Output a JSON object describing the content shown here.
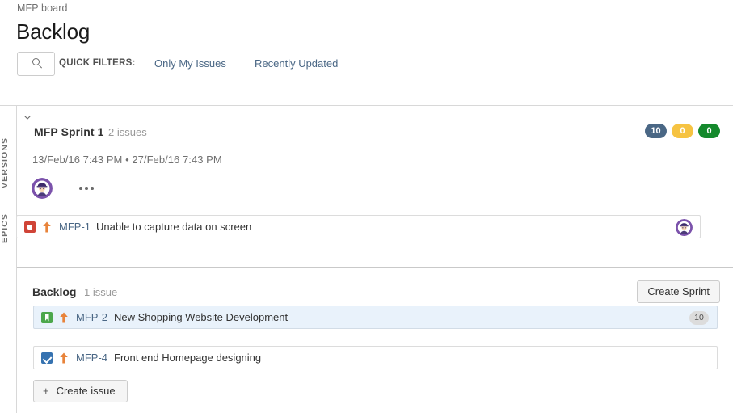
{
  "header": {
    "breadcrumb": "MFP board",
    "title": "Backlog",
    "quick_filters_label": "QUICK FILTERS:",
    "quick_filters": [
      {
        "label": "Only My Issues"
      },
      {
        "label": "Recently Updated"
      }
    ],
    "search_placeholder": "",
    "search_value": "",
    "search_icon": "search-icon"
  },
  "rail": {
    "versions_label": "VERSIONS",
    "epics_label": "EPICS"
  },
  "sprint": {
    "toggle_icon": "chevron-down-icon",
    "name": "MFP Sprint 1",
    "issue_count": "2 issues",
    "start_date": "13/Feb/16 7:43 PM",
    "date_separator": "•",
    "end_date": "27/Feb/16 7:43 PM",
    "dates": "13/Feb/16 7:43 PM • 27/Feb/16 7:43 PM",
    "avatar_name": "sprint-avatar",
    "more_icon": "more-options-icon",
    "badges": [
      {
        "value": "10",
        "color": "#4a6785",
        "name": "todo-count-badge"
      },
      {
        "value": "0",
        "color": "#f6c342",
        "name": "inprogress-count-badge"
      },
      {
        "value": "0",
        "color": "#14892c",
        "name": "done-count-badge"
      }
    ],
    "issues": [
      {
        "type": "bug",
        "type_icon": "bug-icon",
        "priority": "major",
        "priority_icon": "priority-up-arrow-icon",
        "key": "MFP-1",
        "summary": "Unable to capture data on screen",
        "selected": false,
        "has_avatar": true,
        "estimate": ""
      }
    ]
  },
  "backlog": {
    "title": "Backlog",
    "issue_count": "1 issue",
    "create_sprint_label": "Create Sprint",
    "create_issue_label": "Create issue",
    "create_issue_plus": "+",
    "issues": [
      {
        "type": "story",
        "type_icon": "story-icon",
        "priority": "major",
        "priority_icon": "priority-up-arrow-icon",
        "key": "MFP-2",
        "summary": "New Shopping Website Development",
        "selected": true,
        "has_avatar": false,
        "estimate": "10"
      },
      {
        "type": "task",
        "type_icon": "task-icon",
        "priority": "major",
        "priority_icon": "priority-up-arrow-icon",
        "key": "MFP-4",
        "summary": "Front end Homepage designing",
        "selected": false,
        "has_avatar": false,
        "estimate": ""
      }
    ]
  },
  "colors": {
    "link": "#4a6785",
    "bug": "#d04437",
    "story": "#4ca74c",
    "task": "#3572b0",
    "priority_major": "#e8833a",
    "selected_row": "#e9f2fb",
    "avatar_purple": "#7b52ab"
  }
}
